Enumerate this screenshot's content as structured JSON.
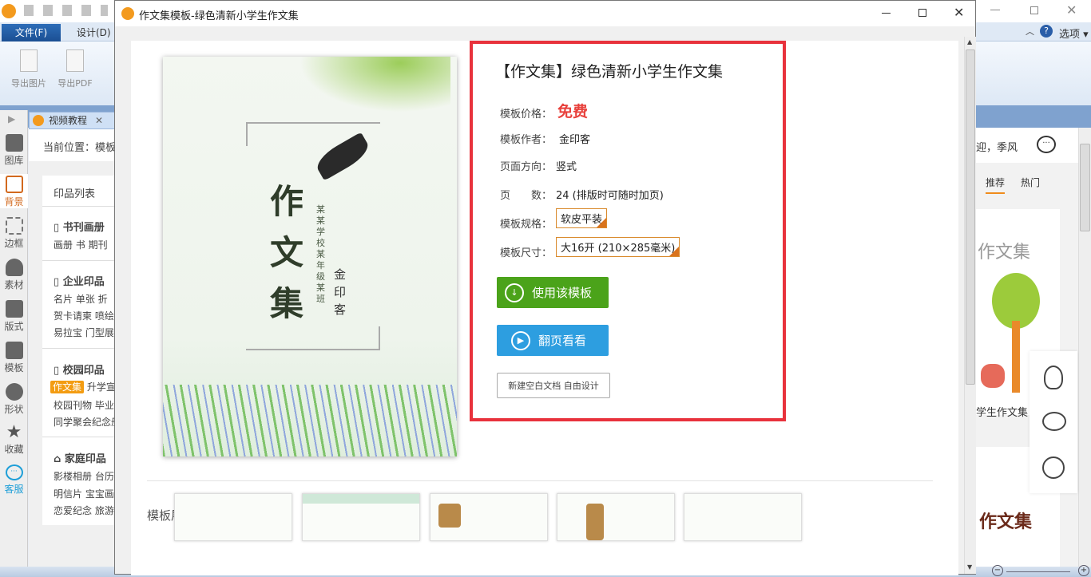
{
  "app": {
    "ribbon_tabs": {
      "file": "文件(F)",
      "design": "设计(D)"
    },
    "ribbon_buttons": {
      "export_image": "导出图片",
      "export_pdf": "导出PDF"
    },
    "options": "选项",
    "doc_tab": "视频教程",
    "location": "当前位置：模板",
    "sidebar": [
      "图库",
      "背景",
      "边框",
      "素材",
      "版式",
      "模板",
      "形状",
      "收藏",
      "客服"
    ],
    "print_list": {
      "title": "印品列表",
      "sections": [
        {
          "title": "书刊画册",
          "lines": [
            "画册  书  期刊"
          ]
        },
        {
          "title": "企业印品",
          "lines": [
            "名片  单张  折",
            "贺卡请柬  喷绘",
            "易拉宝  门型展"
          ]
        },
        {
          "title": "校园印品",
          "active": "作文集",
          "lines": [
            "升学宣",
            "校园刊物  毕业",
            "同学聚会纪念册"
          ]
        },
        {
          "title": "家庭印品",
          "lines": [
            "影楼相册  台历",
            "明信片  宝宝画",
            "恋爱纪念  旅游"
          ]
        }
      ]
    },
    "right": {
      "welcome": "迎，季风",
      "tabs": [
        "推荐",
        "热门"
      ],
      "card1_title": "作文集",
      "card1_caption": "学生作文集",
      "card2_title": "作文集"
    }
  },
  "dialog": {
    "title": "作文集模板-绿色清新小学生作文集",
    "cover": {
      "title": "作文集",
      "subtitle": "某某学校某年级某班",
      "author": "金印客"
    },
    "product_title": "【作文集】绿色清新小学生作文集",
    "fields": [
      {
        "label": "模板价格：",
        "value": "免费"
      },
      {
        "label": "模板作者：",
        "value": "金印客"
      },
      {
        "label": "页面方向：",
        "value": "竖式"
      },
      {
        "label": "页　　数：",
        "value": "24 (排版时可随时加页)"
      },
      {
        "label": "模板规格：",
        "value": "软皮平装"
      },
      {
        "label": "模板尺寸：",
        "value": "大16开 (210×285毫米)"
      }
    ],
    "use_button": "使用该模板",
    "flip_button": "翻页看看",
    "blank_button": "新建空白文档 自由设计",
    "showcase_title": "模板展示",
    "colors": {
      "price": "#e8413c",
      "use": "#4ba31a",
      "flip": "#2d9ee0",
      "highlight": "#e8323c"
    }
  }
}
